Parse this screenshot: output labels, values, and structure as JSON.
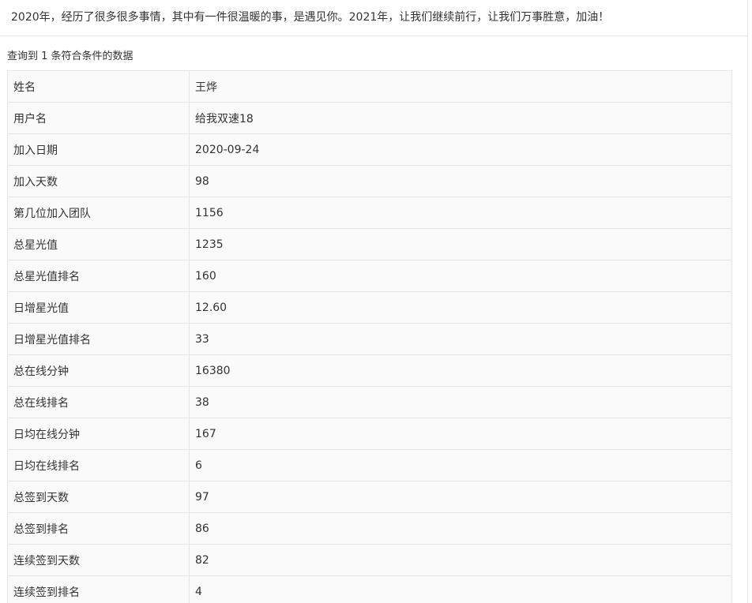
{
  "banner": {
    "text": "2020年，经历了很多很多事情，其中有一件很温暖的事，是遇见你。2021年，让我们继续前行，让我们万事胜意，加油！"
  },
  "result_summary": "查询到 1 条符合条件的数据",
  "records": [
    {
      "label": "姓名",
      "value": "王烨"
    },
    {
      "label": "用户名",
      "value": "给我双速18"
    },
    {
      "label": "加入日期",
      "value": "2020-09-24"
    },
    {
      "label": "加入天数",
      "value": "98"
    },
    {
      "label": "第几位加入团队",
      "value": "1156"
    },
    {
      "label": "总星光值",
      "value": "1235"
    },
    {
      "label": "总星光值排名",
      "value": "160"
    },
    {
      "label": "日增星光值",
      "value": "12.60"
    },
    {
      "label": "日增星光值排名",
      "value": "33"
    },
    {
      "label": "总在线分钟",
      "value": "16380"
    },
    {
      "label": "总在线排名",
      "value": "38"
    },
    {
      "label": "日均在线分钟",
      "value": "167"
    },
    {
      "label": "日均在线排名",
      "value": "6"
    },
    {
      "label": "总签到天数",
      "value": "97"
    },
    {
      "label": "总签到排名",
      "value": "86"
    },
    {
      "label": "连续签到天数",
      "value": "82"
    },
    {
      "label": "连续签到排名",
      "value": "4"
    }
  ]
}
